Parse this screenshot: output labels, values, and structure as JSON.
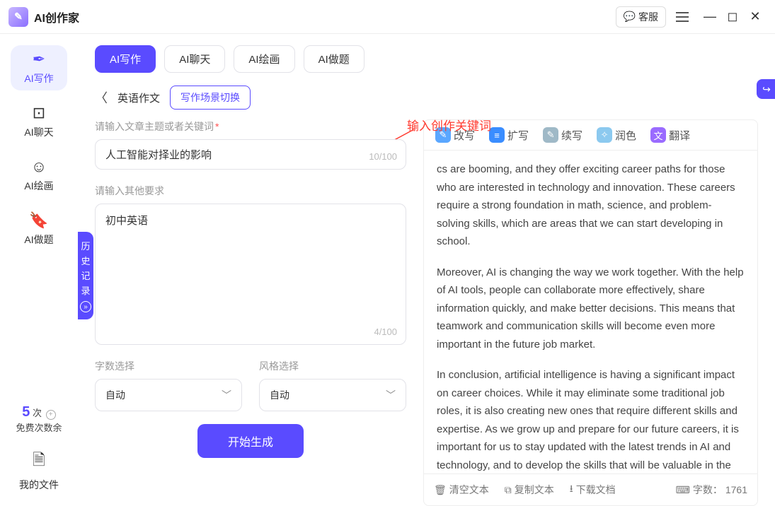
{
  "app": {
    "title": "AI创作家"
  },
  "titlebar": {
    "cs_label": "客服"
  },
  "annotation": {
    "text": "输入创作关键词"
  },
  "sidebar": {
    "items": [
      {
        "label": "AI写作"
      },
      {
        "label": "AI聊天"
      },
      {
        "label": "AI绘画"
      },
      {
        "label": "AI做题"
      }
    ],
    "quota_num": "5",
    "quota_unit": "次",
    "quota_sub": "免费次数余",
    "myfiles": "我的文件",
    "history": "历史记录"
  },
  "tabs": [
    {
      "label": "AI写作"
    },
    {
      "label": "AI聊天"
    },
    {
      "label": "AI绘画"
    },
    {
      "label": "AI做题"
    }
  ],
  "subnav": {
    "crumb": "英语作文",
    "scene_btn": "写作场景切换"
  },
  "form": {
    "topic_label": "请输入文章主题或者关键词",
    "topic_value": "人工智能对择业的影响",
    "topic_count": "10",
    "topic_max": "/100",
    "other_label": "请输入其他要求",
    "other_value": "初中英语",
    "other_count": "4",
    "other_max": "/100",
    "wordcount_label": "字数选择",
    "wordcount_value": "自动",
    "style_label": "风格选择",
    "style_value": "自动",
    "generate_btn": "开始生成"
  },
  "actions": {
    "rewrite": "改写",
    "expand": "扩写",
    "continue": "续写",
    "polish": "润色",
    "translate": "翻译"
  },
  "output": {
    "p1": "cs are booming, and they offer exciting career paths for those who are interested in technology and innovation. These careers require a strong foundation in math, science, and problem-solving skills, which are areas that we can start developing in school.",
    "p2": "Moreover, AI is changing the way we work together. With the help of AI tools, people can collaborate more effectively, share information quickly, and make better decisions. This means that teamwork and communication skills will become even more important in the future job market.",
    "p3": "In conclusion, artificial intelligence is having a significant impact on career choices. While it may eliminate some traditional job roles, it is also creating new ones that require different skills and expertise. As we grow up and prepare for our future careers, it is important for us to stay updated with the latest trends in AI and technology, and to develop the skills that will be valuable in the job market of tomorrow."
  },
  "footer": {
    "clear": "清空文本",
    "copy": "复制文本",
    "download": "下载文档",
    "wc_label": "字数：",
    "wc_value": "1761"
  }
}
